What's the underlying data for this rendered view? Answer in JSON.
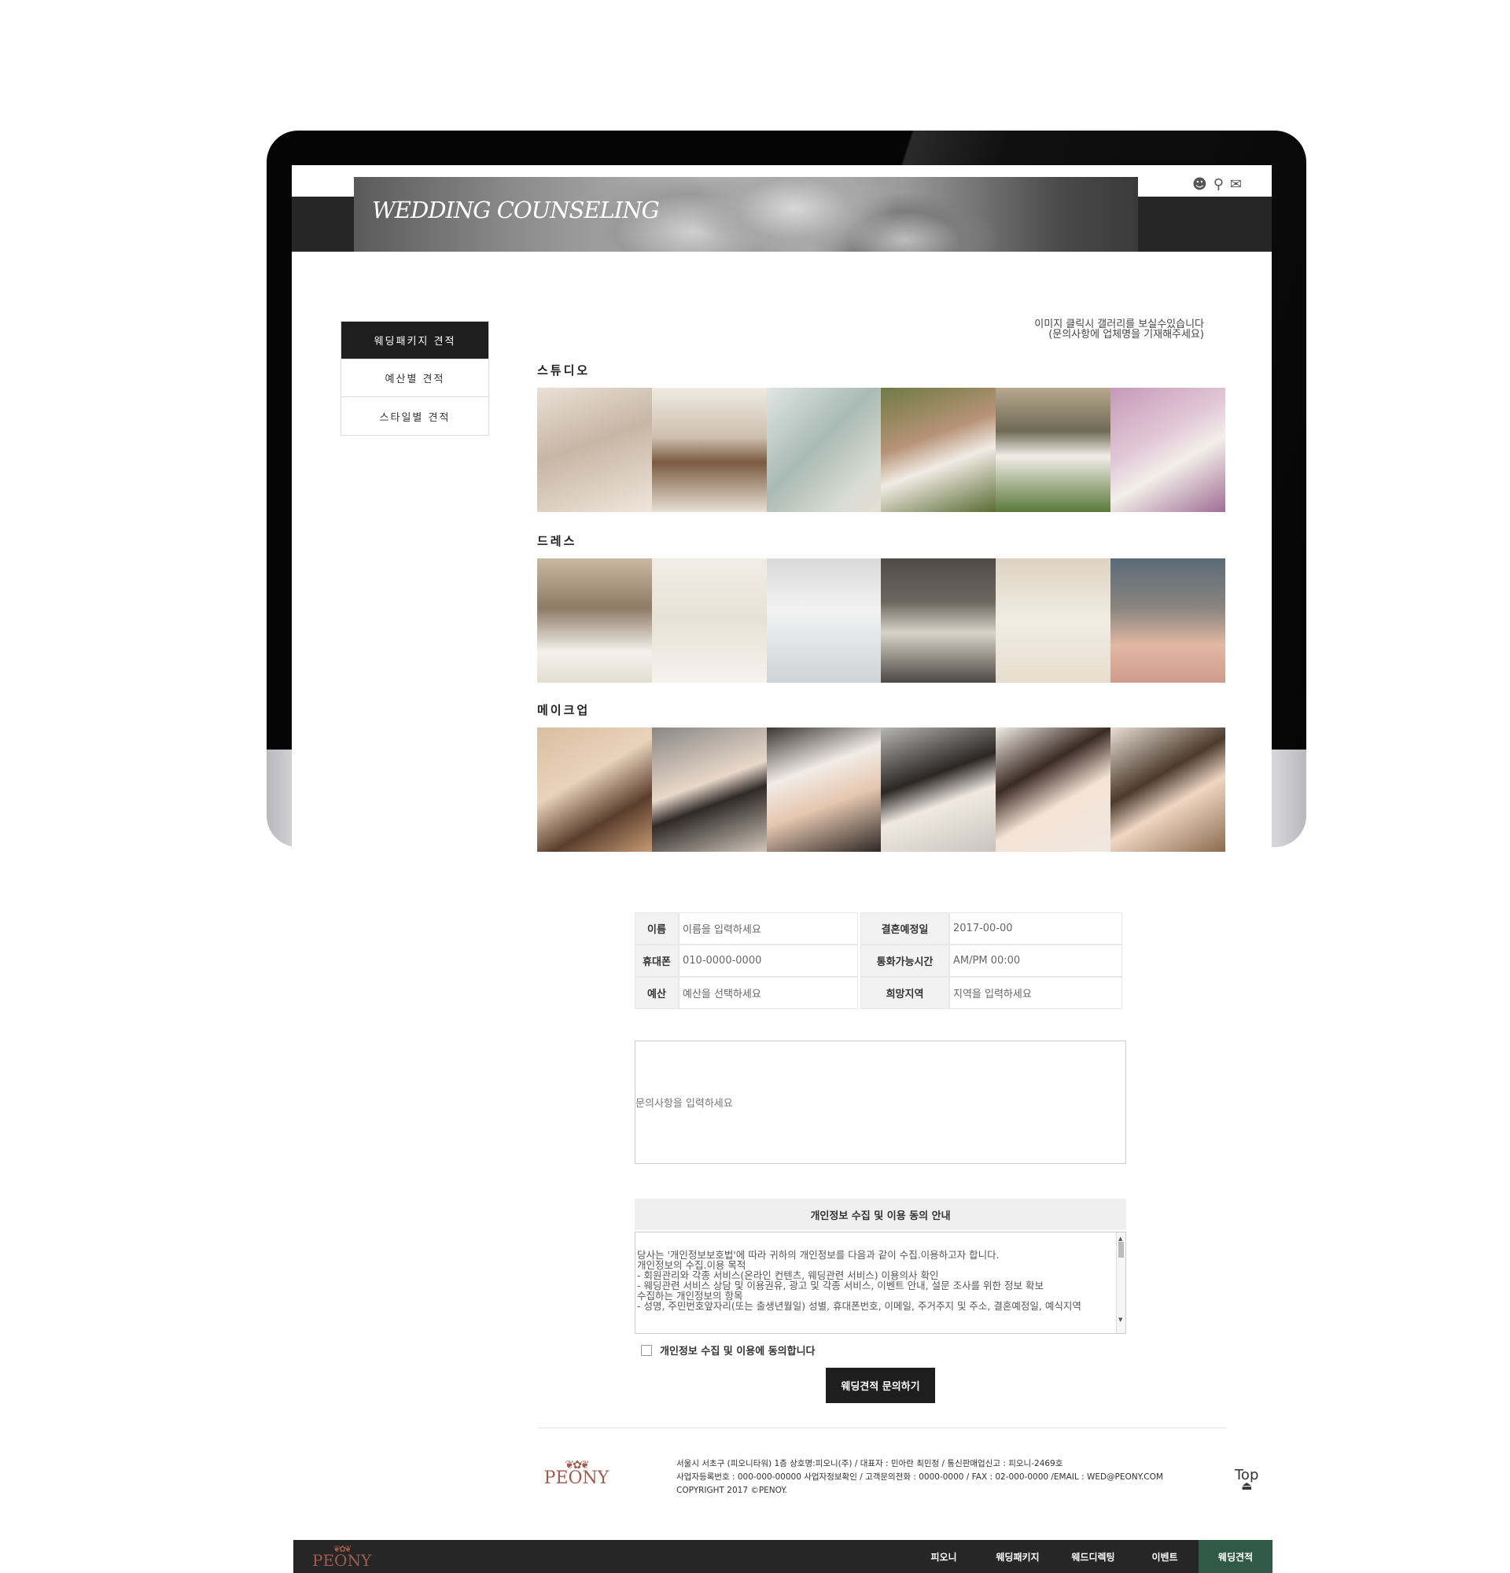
{
  "header": {
    "title": "WEDDING COUNSELING",
    "icons": [
      "user-icon",
      "key-icon",
      "mail-icon"
    ]
  },
  "side_menu": {
    "items": [
      {
        "label": "웨딩패키지 견적",
        "active": true
      },
      {
        "label": "예산별 견적",
        "active": false
      },
      {
        "label": "스타일별 견적",
        "active": false
      }
    ]
  },
  "notice": {
    "line1": "이미지 클릭시 갤러리를 보실수있습니다",
    "line2": "(문의사항에 업체명을 기재해주세요)"
  },
  "sections": [
    {
      "title": "스튜디오"
    },
    {
      "title": "드레스"
    },
    {
      "title": "메이크업"
    }
  ],
  "form": {
    "name_label": "이름",
    "name_placeholder": "이름을 입력하세요",
    "date_label": "결혼예정일",
    "date_value": "2017-00-00",
    "phone_label": "휴대폰",
    "phone_value": "010-0000-0000",
    "calltime_label": "통화가능시간",
    "calltime_value": "AM/PM 00:00",
    "budget_label": "예산",
    "budget_placeholder": "예산을 선택하세요",
    "region_label": "희망지역",
    "region_placeholder": "지역을 입력하세요",
    "inquiry_placeholder": "문의사항을 입력하세요"
  },
  "privacy": {
    "title": "개인정보 수집 및 이용 동의 안내",
    "text_lines": [
      "당사는 '개인정보보호법'에 따라 귀하의 개인정보를 다음과 같이 수집.이용하고자 합니다.",
      "개인정보의 수집.이용 목적",
      "- 회원관리와 각종 서비스(온라인 컨텐츠, 웨딩관련 서비스) 이용의사 확인",
      "- 웨딩관련 서비스 상담 및 이용권유, 광고 및 각종 서비스, 이벤트 안내, 설문 조사를 위한 정보 확보",
      "",
      "수집하는 개인정보의 항목",
      "- 성명, 주민번호앞자리(또는 출생년월일) 성별, 휴대폰번호, 이메일, 주거주지 및 주소, 결혼예정일, 예식지역"
    ],
    "agree_label": "개인정보 수집 및 이용에 동의합니다",
    "submit_label": "웨딩견적 문의하기"
  },
  "footer": {
    "logo": "PEONY",
    "line1": "서울시 서초구 (피오니타워) 1층 상호명:피오니(주) / 대표자 : 민아란 최민정 / 통신판매업신고 : 피오니-2469호",
    "line2": "사업자등록번호 : 000-000-00000 사업자정보확인 / 고객문의전화 : 0000-0000 / FAX : 02-000-0000 /EMAIL : WED@PEONY.COM",
    "line3": "COPYRIGHT 2017 ©PENOY.",
    "top_label": "Top"
  },
  "bottom_nav": {
    "logo": "PEONY",
    "items": [
      "피오니",
      "웨딩패키지",
      "웨드디렉팅",
      "이벤트",
      "웨딩견적"
    ],
    "active_index": 4,
    "active_color": "#2f5a47"
  }
}
